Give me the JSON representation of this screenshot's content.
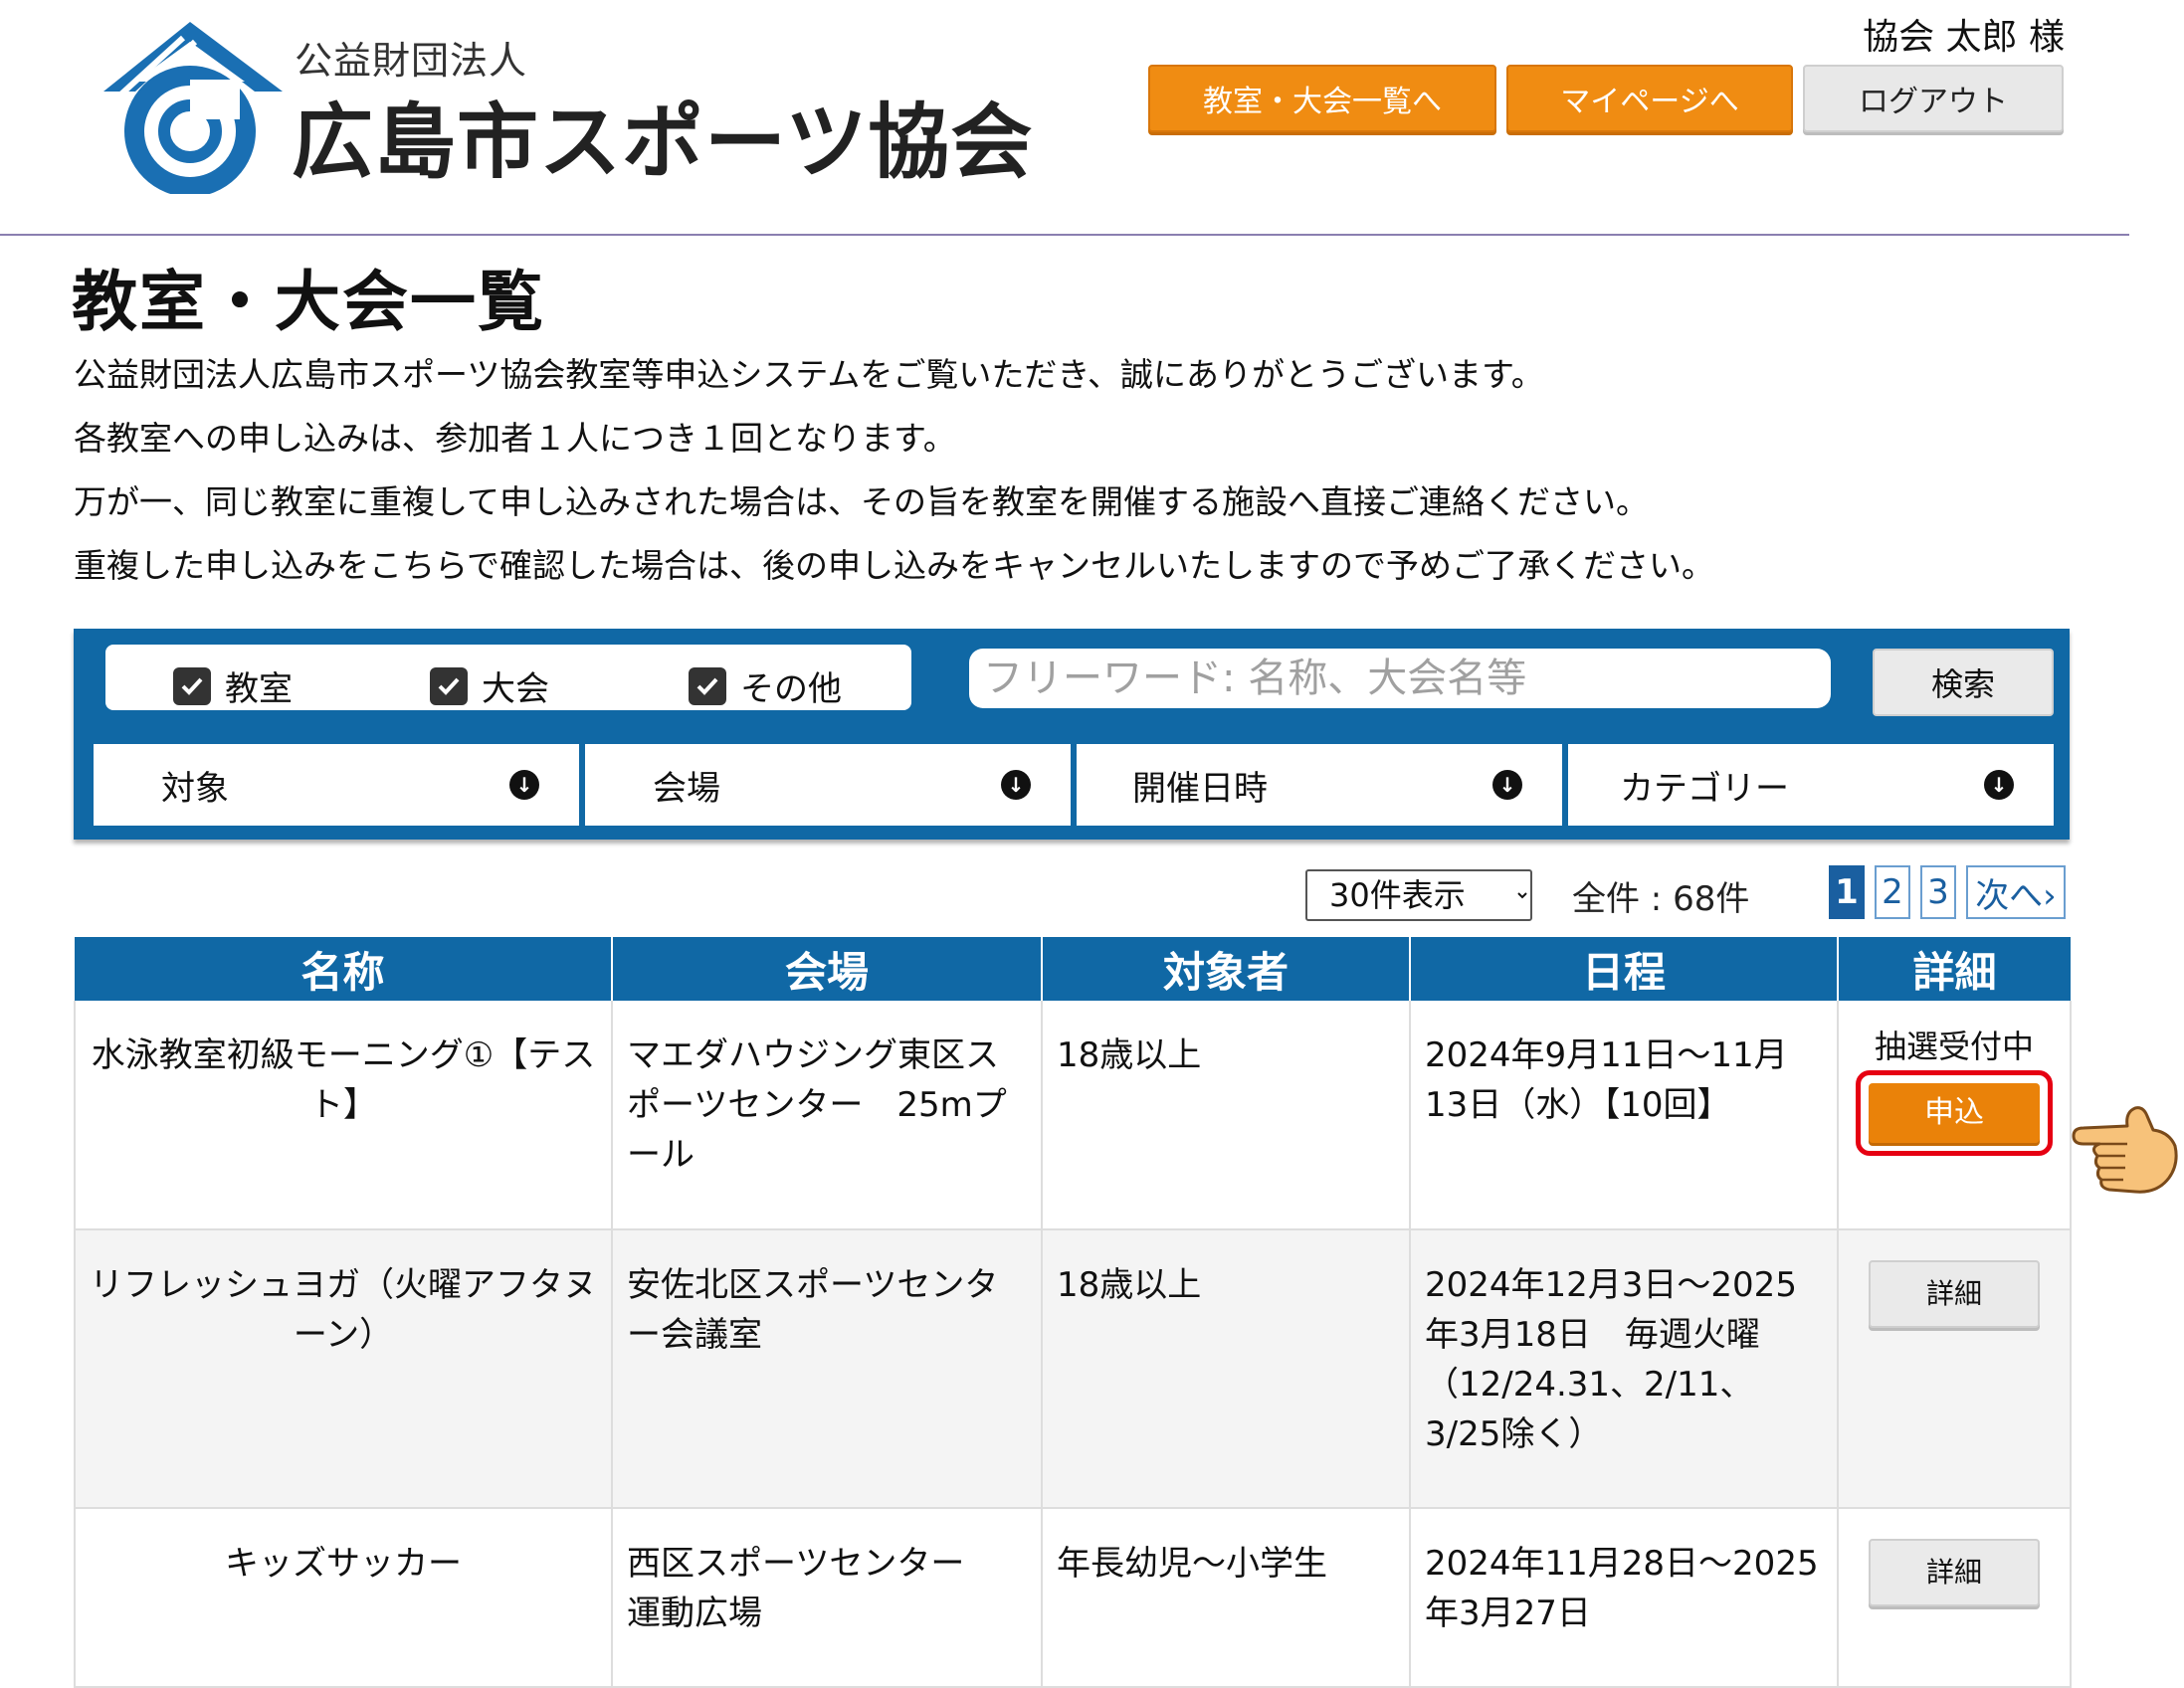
{
  "header": {
    "org_small": "公益財団法人",
    "org_name": "広島市スポーツ協会",
    "user_name": "協会 太郎 様",
    "buttons": {
      "list": "教室・大会一覧へ",
      "mypage": "マイページへ",
      "logout": "ログアウト"
    }
  },
  "intro": {
    "title": "教室・大会一覧",
    "lines": [
      "公益財団法人広島市スポーツ協会教室等申込システムをご覧いただき、誠にありがとうございます。",
      "各教室への申し込みは、参加者１人につき１回となります。",
      "万が一、同じ教室に重複して申し込みされた場合は、その旨を教室を開催する施設へ直接ご連絡ください。",
      "重複した申し込みをこちらで確認した場合は、後の申し込みをキャンセルいたしますので予めご了承ください。"
    ]
  },
  "search": {
    "checkboxes": [
      {
        "label": "教室",
        "checked": true
      },
      {
        "label": "大会",
        "checked": true
      },
      {
        "label": "その他",
        "checked": true
      }
    ],
    "placeholder": "フリーワード: 名称、大会名等",
    "button": "検索",
    "dropdowns": [
      "対象",
      "会場",
      "開催日時",
      "カテゴリー"
    ]
  },
  "pagination": {
    "per_page": "30件表示",
    "total": "全件 : 68件",
    "pages": [
      "1",
      "2",
      "3"
    ],
    "current": "1",
    "next": "次へ›"
  },
  "table": {
    "headers": [
      "名称",
      "会場",
      "対象者",
      "日程",
      "詳細"
    ],
    "rows": [
      {
        "name": "水泳教室初級モーニング①【テスト】",
        "venue": "マエダハウジング東区スポーツセンター　25mプール",
        "target": "18歳以上",
        "schedule": "2024年9月11日～11月13日（水）【10回】",
        "status": "抽選受付中",
        "button": "申込"
      },
      {
        "name": "リフレッシュヨガ（火曜アフタヌーン）",
        "venue": "安佐北区スポーツセンター会議室",
        "target": "18歳以上",
        "schedule": "2024年12月3日～2025年3月18日　毎週火曜（12/24.31、2/11、3/25除く）",
        "status": "",
        "button": "詳細"
      },
      {
        "name": "キッズサッカー",
        "venue": "西区スポーツセンター　運動広場",
        "target": "年長幼児～小学生",
        "schedule": "2024年11月28日～2025年3月27日",
        "status": "",
        "button": "詳細"
      }
    ]
  },
  "colors": {
    "primary_blue": "#1068a5",
    "orange": "#f08c12",
    "highlight_red": "#e60012"
  }
}
